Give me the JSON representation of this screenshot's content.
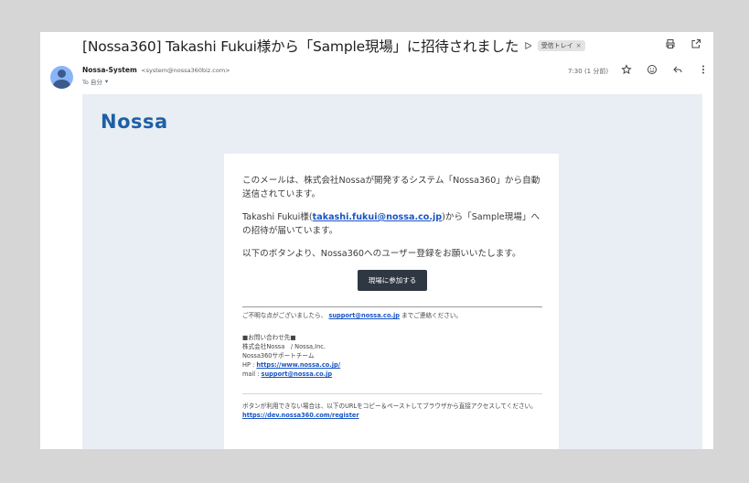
{
  "subject": "[Nossa360] Takashi Fukui様から「Sample現場」に招待されました",
  "label": "受信トレイ",
  "label_close": "×",
  "importance_icon": "ᐅ",
  "sender": {
    "name": "Nossa-System",
    "email": "<system@nossa360biz.com>",
    "to": "To 自分",
    "to_caret": "▾"
  },
  "time": "7:30 (1 分前)",
  "icons": {
    "print": "print-icon",
    "open_new": "open-in-new-icon",
    "star": "star-icon",
    "emoji": "emoji-icon",
    "reply": "reply-icon",
    "more": "more-vert-icon"
  },
  "email_body": {
    "logo": "Nossa",
    "paragraph1": "このメールは、株式会社Nossaが開発するシステム「Nossa360」から自動送信されています。",
    "p2_before": "Takashi Fukui様(",
    "p2_link": "takashi.fukui@nossa.co.jp",
    "p2_after": ")から「Sample現場」への招待が届いています。",
    "paragraph3": "以下のボタンより、Nossa360へのユーザー登録をお願いいたします。",
    "button": "現場に参加する",
    "contact_before": "ご不明な点がございましたら、 ",
    "contact_link": "support@nossa.co.jp",
    "contact_after": " までご連絡ください。",
    "inquiry_title": "■お問い合わせ先■",
    "company": "株式会社Nossa　/ Nossa,Inc.",
    "team": "Nossa360サポートチーム",
    "hp_label": "HP : ",
    "hp_link": "https://www.nossa.co.jp/",
    "mail_label": "mail : ",
    "mail_link": "support@nossa.co.jp",
    "footer_text": "ボタンが利用できない場合は、以下のURLをコピー＆ペーストしてブラウザから直接アクセスしてください。",
    "footer_link": "https://dev.nossa360.com/register"
  }
}
